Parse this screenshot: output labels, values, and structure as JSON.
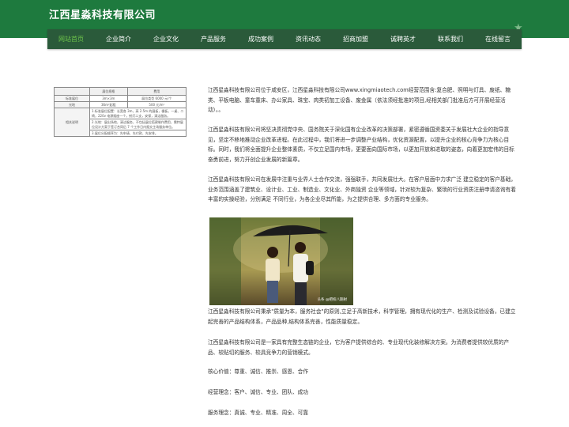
{
  "brand": "江西星淼科技有限公司",
  "nav": [
    "网站首页",
    "企业简介",
    "企业文化",
    "产品服务",
    "成功案例",
    "资讯动态",
    "招商加盟",
    "诚聘英才",
    "联系我们",
    "在线留言"
  ],
  "table": {
    "headers": [
      "",
      "展位规格",
      "费用"
    ],
    "rows": [
      [
        "标准展位",
        "3m×3m",
        "展位类型 6000 元/个"
      ],
      [
        "光地",
        "36m²起租",
        "500 元/m²"
      ]
    ],
    "remark_label": "相关说明",
    "remarks": [
      "1.标准展位配置：长宽各 3m，高 2.5m 的展板，楣板，一桌、二椅，220v 电源插座一个，射灯二支，安保，清洁服务。",
      "2.光地：展出场地，清洁服务，不包括展位搭建制作费用，需特展位设计方案于签订合同后 7 个工作日内报交主场服务单位。",
      "3.展位分配顺序为：先申请、先付款、先安排。"
    ]
  },
  "paragraphs": [
    "江西星淼科技有限公司位于咸安区，江西星淼科技有限公司www.xingmiaotech.com经营范围含:复合肥、照明与灯具、废纸、糖类、平板电脑、童车童床、办公家具、珠宝、肉类初加工设备、废金属（依法须经批准的项目,经相关部门批准后方可开展经营活动）。。",
    "江西星淼科技有限公司将坚决贯彻党中央、国务院关于深化国有企业改革的决策部署，紧密遵循国资委关于发展社大企业的指导意见，坚定不移地推动企业改革进程。在此过程中，我们将进一步调整产业结构，优化资源配置，以提升企业的核心竞争力为核心目标。同时，我们将全面提升企业整体素质，不仅立足国内市场，更要面向国际市场，以更加开放和进取的姿态，向着更加宏伟的目标奋勇前进，努力开创企业发展的新篇章。",
    "江西星淼科技有限公司在发展中注重与业界人士合作交流，强强联手，共同发展壮大。在客户层面中力求广泛 建立稳定的客户基础，业务范围涵盖了建筑业、设计业、工业、制造业、文化业、外商独资 企业等领域，针对较为复杂、繁琐的行业资质注册申请咨询有着丰富的实操经验，分别满足 不同行业，为各企业尽其所能，为之提供合理、多方面的专业服务。",
    "江西星淼科技有限公司秉承\"质量为本，服务社会\"的原则,立足于高新技术，科学管理，拥有现代化的生产、检测及试验设备，已建立起完善的产品结构体系，产品品种,结构体系完善，性能质量稳定。",
    "江西星淼科技有限公司是一家具有完整生态链的企业，它为客户提供综合的、专业现代化装修解决方案。为消费者提供较优质的产品、较贴切的服务、较具竞争力的营销模式。",
    "核心价值：尊重、诚信、推崇、感恩、合作",
    "经营理念：客户、诚信、专业、团队、成功",
    "服务理念：真诚、专业、精准、周全、可靠"
  ],
  "photo": {
    "caption": "头条 @把校八期射"
  },
  "colors": {
    "header_green": "#1e7a3e",
    "nav_bg": "#2a5a3a",
    "nav_active": "#6cc24a"
  }
}
